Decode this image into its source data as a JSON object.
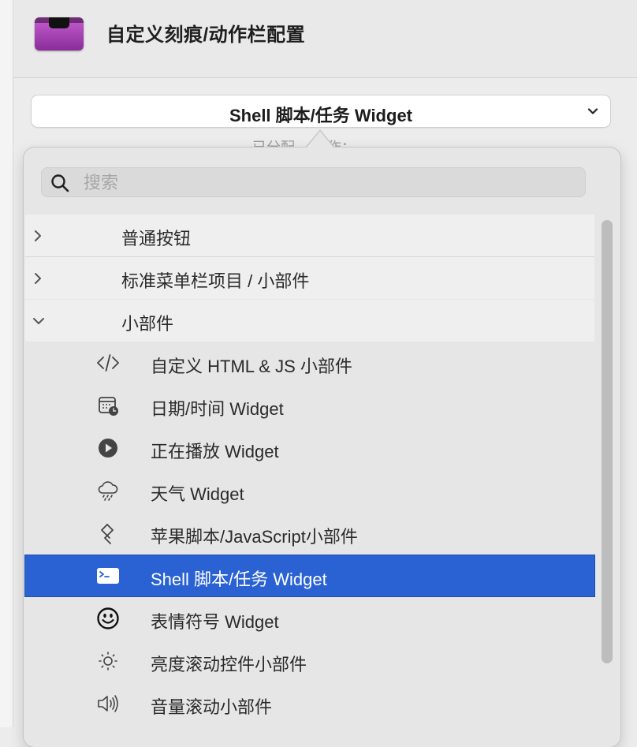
{
  "header": {
    "title": "自定义刻痕/动作栏配置"
  },
  "popup": {
    "selected": "Shell 脚本/任务 Widget"
  },
  "under_text": "已分配 　操作：",
  "search": {
    "placeholder": "搜索"
  },
  "groups": [
    {
      "label": "普通按钮",
      "expanded": false
    },
    {
      "label": "标准菜单栏项目 / 小部件",
      "expanded": false
    },
    {
      "label": "小部件",
      "expanded": true
    }
  ],
  "items": [
    {
      "label": "自定义 HTML & JS 小部件",
      "icon": "code-icon"
    },
    {
      "label": "日期/时间 Widget",
      "icon": "calendar-clock-icon"
    },
    {
      "label": "正在播放 Widget",
      "icon": "play-circle-icon"
    },
    {
      "label": "天气 Widget",
      "icon": "cloud-rain-icon"
    },
    {
      "label": "苹果脚本/JavaScript小部件",
      "icon": "script-icon"
    },
    {
      "label": "Shell 脚本/任务 Widget",
      "icon": "terminal-icon",
      "selected": true
    },
    {
      "label": "表情符号 Widget",
      "icon": "smiley-icon"
    },
    {
      "label": "亮度滚动控件小部件",
      "icon": "brightness-icon"
    },
    {
      "label": "音量滚动小部件",
      "icon": "speaker-icon"
    }
  ],
  "colors": {
    "selection": "#2a62d3",
    "app_icon": "#b04fc0"
  }
}
